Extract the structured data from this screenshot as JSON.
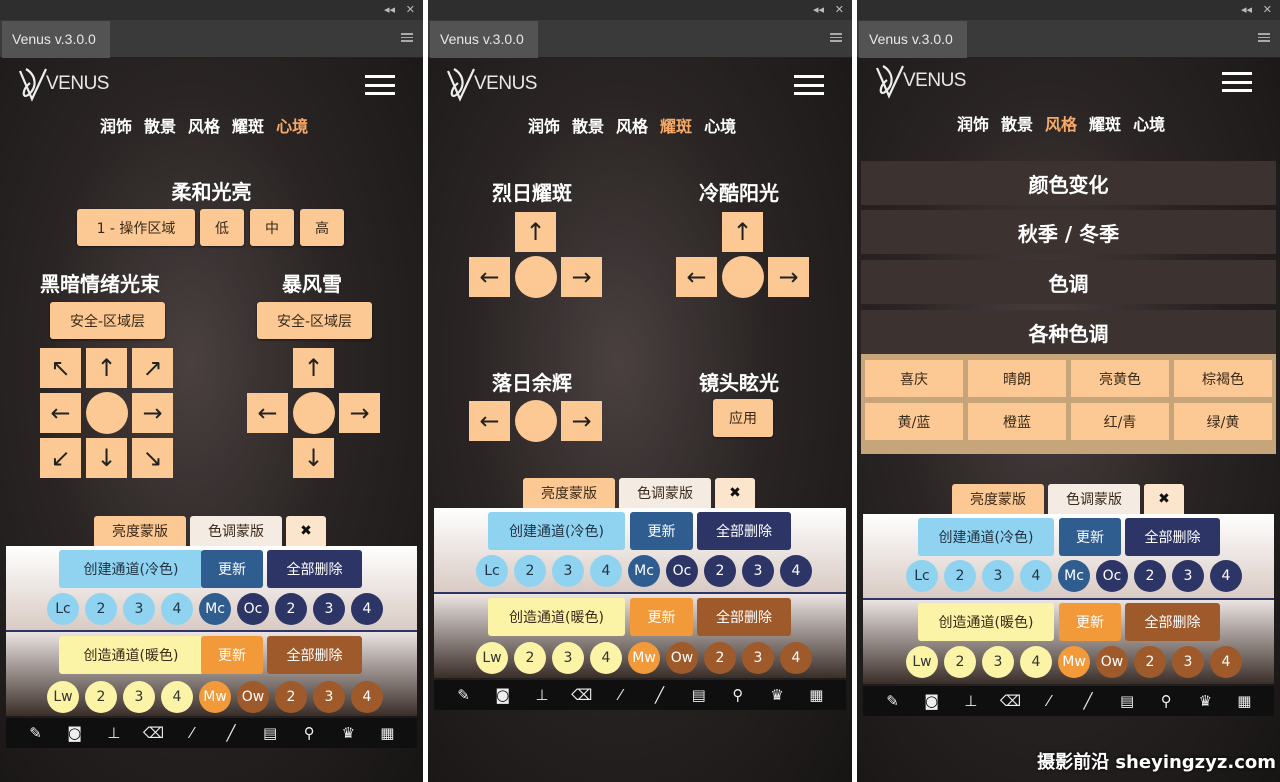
{
  "window": {
    "tab_title": "Venus v.3.0.0",
    "collapse_icon": "double-chevron-left",
    "close_icon": "close"
  },
  "logo_text": "VENUS",
  "nav": [
    "润饰",
    "散景",
    "风格",
    "耀斑",
    "心境"
  ],
  "panel1": {
    "active_nav": "心境",
    "soft_light": {
      "title": "柔和光亮",
      "buttons": [
        "1 - 操作区域",
        "低",
        "中",
        "高"
      ]
    },
    "dark_beam": {
      "title": "黑暗情绪光束",
      "button": "安全-区域层"
    },
    "blizzard": {
      "title": "暴风雪",
      "button": "安全-区域层"
    },
    "arrows8": [
      "↖",
      "↑",
      "↗",
      "←",
      "→",
      "↙",
      "↓",
      "↘"
    ],
    "arrows4": [
      "↑",
      "←",
      "→",
      "↓"
    ]
  },
  "panel2": {
    "active_nav": "耀斑",
    "sunflare": {
      "title": "烈日耀斑"
    },
    "cool_sun": {
      "title": "冷酷阳光"
    },
    "sunset": {
      "title": "落日余辉"
    },
    "lens_flare": {
      "title": "镜头眩光",
      "button": "应用"
    }
  },
  "panel3": {
    "active_nav": "风格",
    "sections": [
      "颜色变化",
      "秋季 / 冬季",
      "色调",
      "各种色调"
    ],
    "tones": [
      "喜庆",
      "晴朗",
      "亮黄色",
      "棕褐色",
      "黄/蓝",
      "橙蓝",
      "红/青",
      "绿/黄"
    ]
  },
  "mask_tabs": {
    "luminosity": "亮度蒙版",
    "color": "色调蒙版",
    "close": "✖"
  },
  "cool": {
    "create": "创建通道(冷色)",
    "update": "更新",
    "delete_all": "全部删除",
    "circles": [
      "Lc",
      "2",
      "3",
      "4",
      "Mc",
      "Oc",
      "2",
      "3",
      "4"
    ]
  },
  "warm": {
    "create": "创造通道(暖色)",
    "update": "更新",
    "delete_all": "全部删除",
    "circles": [
      "Lw",
      "2",
      "3",
      "4",
      "Mw",
      "Ow",
      "2",
      "3",
      "4"
    ]
  },
  "tools": [
    "brush-mask-icon",
    "mask-icon",
    "stamp-icon",
    "eraser-icon",
    "pen-icon",
    "brush-icon",
    "gradient-icon",
    "eyedropper-icon",
    "crown-icon",
    "grid-icon"
  ],
  "watermark": "摄影前沿 sheyingzyz.com",
  "colors": {
    "accent": "#fcc994",
    "active_nav": "#f6a968",
    "cool_blue": "#8fd3f0",
    "dark_blue": "#2f5d90",
    "navy": "#2d3566",
    "cream": "#fbf3a6",
    "orange": "#f29a3a",
    "brown": "#9e5a2a"
  }
}
